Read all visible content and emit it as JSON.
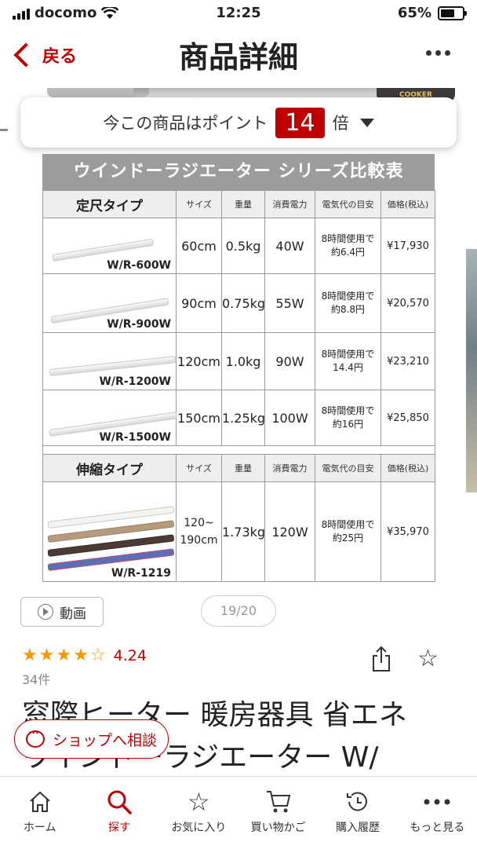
{
  "status_bar": {
    "carrier": "docomo",
    "time": "12:25",
    "battery": "65%"
  },
  "header": {
    "back_label": "戻る",
    "title": "商品詳細"
  },
  "gallery_bg": {
    "badge": "COOKER"
  },
  "points": {
    "prefix": "今この商品はポイント",
    "multiplier": "14",
    "suffix": "倍"
  },
  "comparison": {
    "title": "ウインドーラジエーター シリーズ比較表",
    "fixed": {
      "type_label": "定尺タイプ",
      "headers": [
        "サイズ",
        "重量",
        "消費電力",
        "電気代の目安",
        "価格(税込)"
      ],
      "rows": [
        {
          "model": "W/R-600W",
          "size": "60cm",
          "weight": "0.5kg",
          "power": "40W",
          "cost1": "8時間使用で",
          "cost2": "約6.4円",
          "price": "¥17,930"
        },
        {
          "model": "W/R-900W",
          "size": "90cm",
          "weight": "0.75kg",
          "power": "55W",
          "cost1": "8時間使用で",
          "cost2": "約8.8円",
          "price": "¥20,570"
        },
        {
          "model": "W/R-1200W",
          "size": "120cm",
          "weight": "1.0kg",
          "power": "90W",
          "cost1": "8時間使用で",
          "cost2": "14.4円",
          "price": "¥23,210"
        },
        {
          "model": "W/R-1500W",
          "size": "150cm",
          "weight": "1.25kg",
          "power": "100W",
          "cost1": "8時間使用で",
          "cost2": "約16円",
          "price": "¥25,850"
        }
      ]
    },
    "ext": {
      "type_label": "伸縮タイプ",
      "headers": [
        "サイズ",
        "重量",
        "消費電力",
        "電気代の目安",
        "価格(税込)"
      ],
      "row": {
        "model": "W/R-1219",
        "size1": "120~",
        "size2": "190cm",
        "weight": "1.73kg",
        "power": "120W",
        "cost1": "8時間使用で",
        "cost2": "約25円",
        "price": "¥35,970"
      }
    }
  },
  "media": {
    "video_label": "動画",
    "page_indicator": "19/20"
  },
  "rating": {
    "value": "4.24",
    "count": "34件",
    "stars": 4.24
  },
  "product": {
    "title_line1": "窓際ヒーター 暖房器具 省エネ",
    "title_line2": "ウインドーラジエーター W/"
  },
  "shop_button": "ショップへ相談",
  "tabs": [
    {
      "label": "ホーム",
      "icon": "home-icon"
    },
    {
      "label": "探す",
      "icon": "search-icon"
    },
    {
      "label": "お気に入り",
      "icon": "star-icon"
    },
    {
      "label": "買い物かご",
      "icon": "cart-icon"
    },
    {
      "label": "購入履歴",
      "icon": "history-icon"
    },
    {
      "label": "もっと見る",
      "icon": "more-icon"
    }
  ],
  "colors": {
    "accent": "#bf0000",
    "star": "#f39800"
  }
}
